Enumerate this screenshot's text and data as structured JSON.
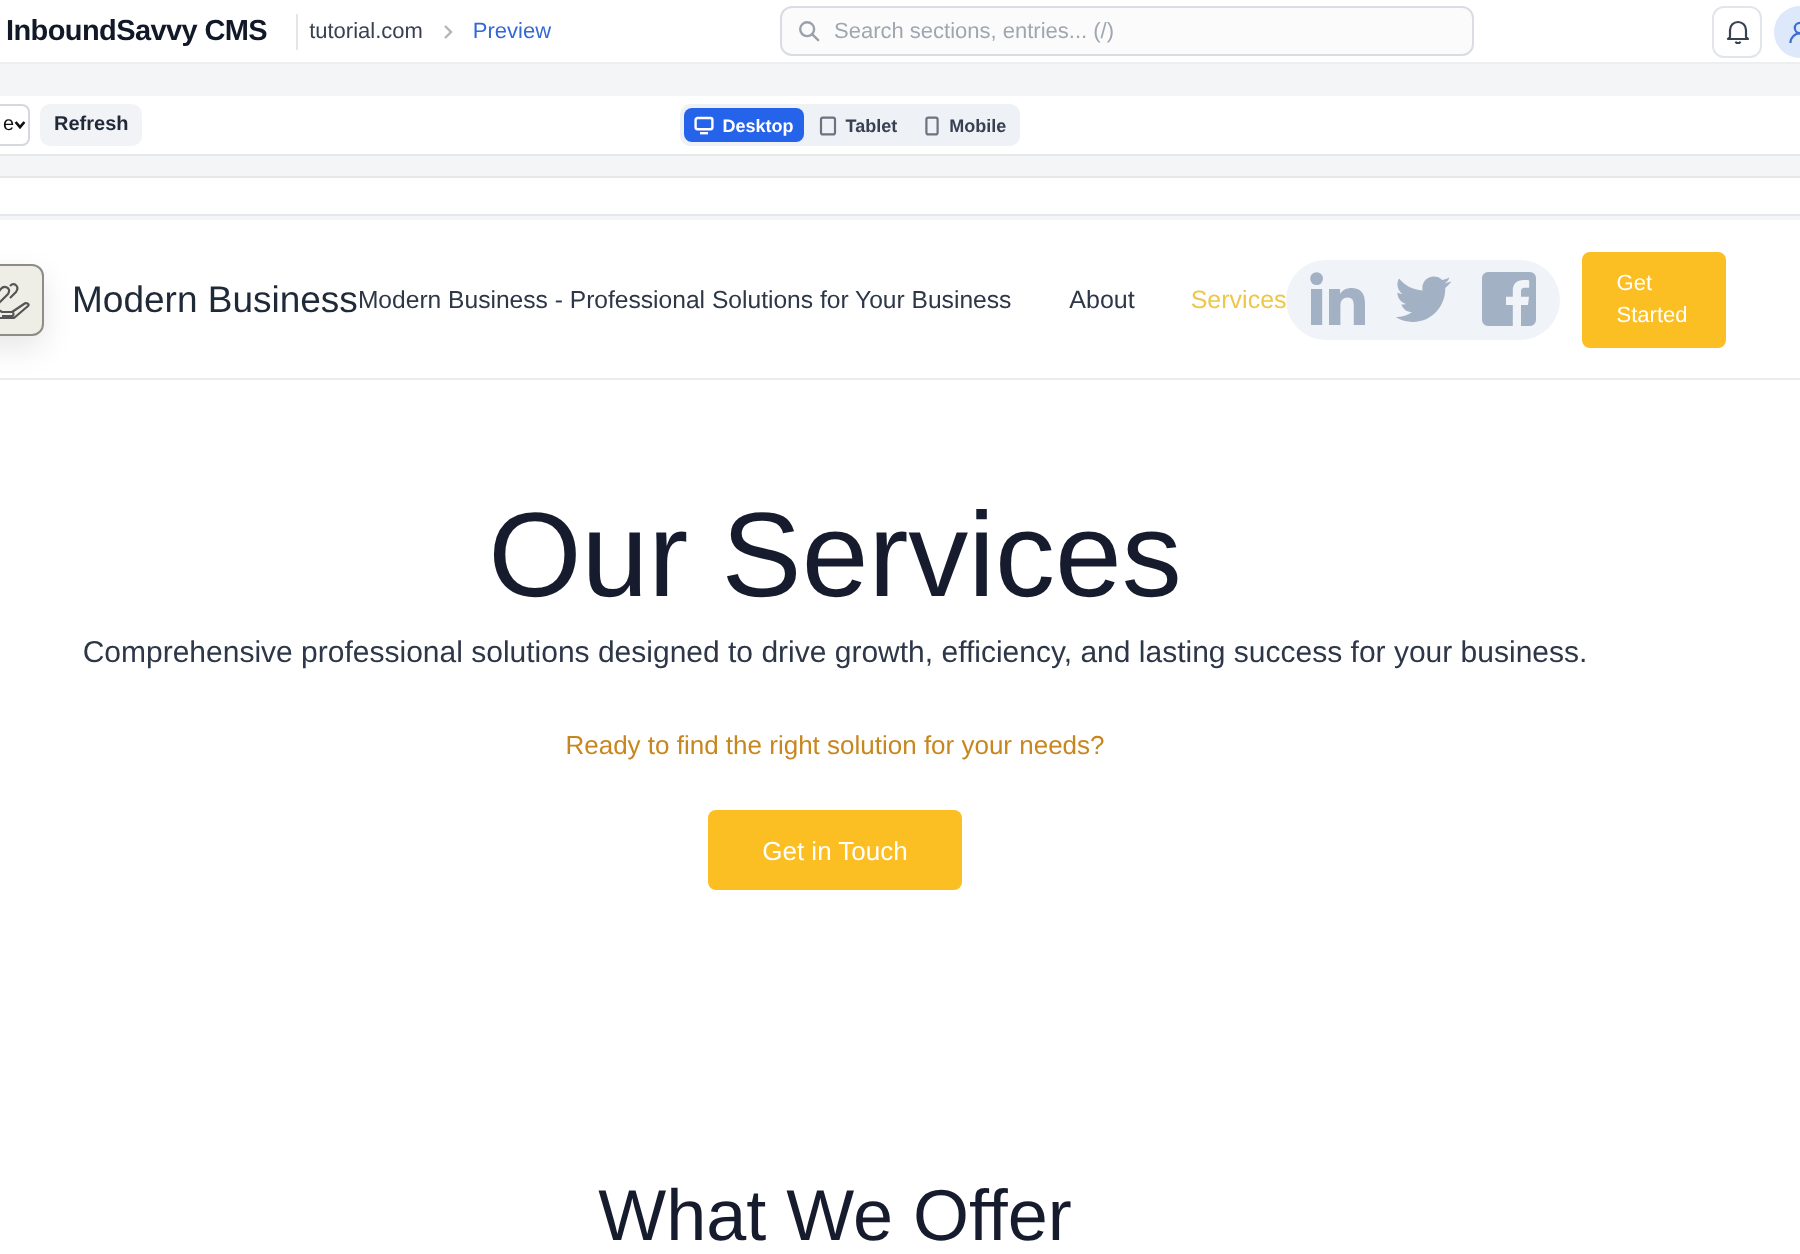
{
  "app_bar": {
    "logo": "InboundSavvy CMS",
    "site_name": "tutorial.com",
    "current_page": "Preview",
    "search": {
      "placeholder": "Search sections, entries... (/)"
    }
  },
  "toolbar": {
    "dropdown": {
      "value": "e"
    },
    "refresh": "Refresh",
    "devices": [
      {
        "label": "Desktop",
        "kind": "desktop",
        "selected": true
      },
      {
        "label": "Tablet",
        "kind": "tablet",
        "selected": false
      },
      {
        "label": "Mobile",
        "kind": "mobile",
        "selected": false
      }
    ]
  },
  "site": {
    "header": {
      "brand": "Modern Business",
      "tagline": "Modern Business - Professional Solutions for Your Business",
      "nav": [
        {
          "label": "About",
          "selected": false
        },
        {
          "label": "Services",
          "selected": true
        }
      ],
      "cta": "Get Started"
    },
    "hero": {
      "title": "Our Services",
      "subtitle": "Comprehensive professional solutions designed to drive growth, efficiency, and lasting success for your business.",
      "prompt": "Ready to find the right solution for your needs?",
      "button": "Get in Touch"
    },
    "section_title": "What We Offer"
  }
}
